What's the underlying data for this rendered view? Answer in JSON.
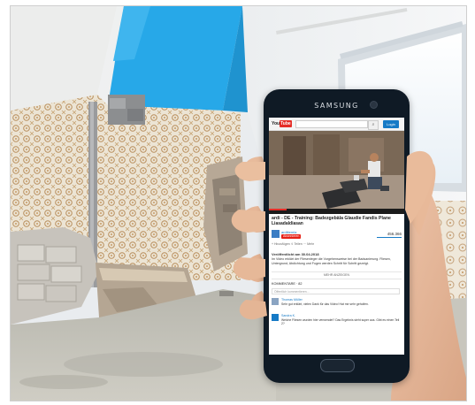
{
  "phone": {
    "brand": "SAMSUNG"
  },
  "youtube": {
    "logo_you": "You",
    "logo_tube": "Tube",
    "search_button": "⌕",
    "signin": "Login",
    "video_title_line1": "ardi - DE - Training: Badezgebäla Glaudie Fandis Plane",
    "video_title_line2": "Liasadaldiasan",
    "channel_name": "ardiitemla",
    "subscribe": "Abonnieren",
    "views": "456.366",
    "actions": "+ Hinzufügen   ⇪ Teilen   ··· Mehr",
    "desc_title": "Veröffentlicht am 30.04.2018",
    "desc_text": "Im Video erklärt der Fliesenleger die Vorgehensweise bei der Badsanierung. Fliesen, Untergrund, Abdichtung und Fugen werden Schritt für Schritt gezeigt.",
    "show_more": "MEHR ANZEIGEN",
    "comments_head": "KOMMENTARE · 82",
    "comment_placeholder": "Öffentlich kommentieren...",
    "comments": [
      {
        "name": "Thomas Müller",
        "text": "Sehr gut erklärt, vielen Dank für das Video! Hat mir sehr geholfen."
      },
      {
        "name": "Sandra K.",
        "text": "Welche Fliesen wurden hier verwendet? Das Ergebnis sieht super aus. Gibt es einen Teil 2?"
      }
    ]
  },
  "colors": {
    "wall_blue": "#27a8e8",
    "youtube_red": "#e52d27",
    "link_blue": "#167ac6"
  }
}
